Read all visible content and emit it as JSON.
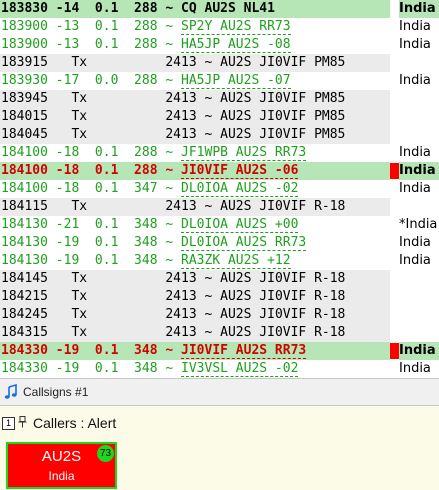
{
  "colors": {
    "rx": "#1fa01f",
    "tx": "#000000",
    "alert": "#d40000",
    "highlight_bg": "#b6e6b6",
    "tx_bg": "#ebebeb",
    "card_bg": "#ff0000",
    "card_border": "#1fd61f"
  },
  "log": [
    {
      "time": "183830",
      "db": "-14",
      "dt": "0.1",
      "freq": "288",
      "sep": "~",
      "msg": "CQ AU2S NL41",
      "country": "India",
      "style": "highlight",
      "mark": ""
    },
    {
      "time": "183900",
      "db": "-13",
      "dt": "0.1",
      "freq": "288",
      "sep": "~",
      "msg": "SP2Y AU2S RR73",
      "country": "India",
      "style": "rx",
      "mark": ""
    },
    {
      "time": "183900",
      "db": "-13",
      "dt": "0.1",
      "freq": "288",
      "sep": "~",
      "msg": "HA5JP AU2S -08",
      "country": "India",
      "style": "rx",
      "mark": ""
    },
    {
      "time": "183915",
      "db": "Tx",
      "dt": "",
      "freq": "2413",
      "sep": "~",
      "msg": "AU2S JI0VIF PM85",
      "country": "",
      "style": "tx",
      "mark": ""
    },
    {
      "time": "183930",
      "db": "-17",
      "dt": "0.0",
      "freq": "288",
      "sep": "~",
      "msg": "HA5JP AU2S -07",
      "country": "India",
      "style": "rx",
      "mark": ""
    },
    {
      "time": "183945",
      "db": "Tx",
      "dt": "",
      "freq": "2413",
      "sep": "~",
      "msg": "AU2S JI0VIF PM85",
      "country": "",
      "style": "tx",
      "mark": ""
    },
    {
      "time": "184015",
      "db": "Tx",
      "dt": "",
      "freq": "2413",
      "sep": "~",
      "msg": "AU2S JI0VIF PM85",
      "country": "",
      "style": "tx",
      "mark": ""
    },
    {
      "time": "184045",
      "db": "Tx",
      "dt": "",
      "freq": "2413",
      "sep": "~",
      "msg": "AU2S JI0VIF PM85",
      "country": "",
      "style": "tx",
      "mark": ""
    },
    {
      "time": "184100",
      "db": "-18",
      "dt": "0.1",
      "freq": "288",
      "sep": "~",
      "msg": "JF1WPB AU2S RR73",
      "country": "India",
      "style": "rx",
      "mark": ""
    },
    {
      "time": "184100",
      "db": "-18",
      "dt": "0.1",
      "freq": "288",
      "sep": "~",
      "msg": "JI0VIF AU2S -06",
      "country": "India",
      "style": "alert",
      "mark": "red"
    },
    {
      "time": "184100",
      "db": "-18",
      "dt": "0.1",
      "freq": "347",
      "sep": "~",
      "msg": "DL0IOA AU2S -02",
      "country": "India",
      "style": "rx",
      "mark": ""
    },
    {
      "time": "184115",
      "db": "Tx",
      "dt": "",
      "freq": "2413",
      "sep": "~",
      "msg": "AU2S JI0VIF R-18",
      "country": "",
      "style": "tx",
      "mark": ""
    },
    {
      "time": "184130",
      "db": "-21",
      "dt": "0.1",
      "freq": "348",
      "sep": "~",
      "msg": "DL0IOA AU2S +00",
      "country": "*India",
      "style": "rx",
      "mark": ""
    },
    {
      "time": "184130",
      "db": "-19",
      "dt": "0.1",
      "freq": "348",
      "sep": "~",
      "msg": "DL0IOA AU2S RR73",
      "country": "India",
      "style": "rx",
      "mark": ""
    },
    {
      "time": "184130",
      "db": "-19",
      "dt": "0.1",
      "freq": "348",
      "sep": "~",
      "msg": "RA3ZK AU2S +12",
      "country": "India",
      "style": "rx",
      "mark": ""
    },
    {
      "time": "184145",
      "db": "Tx",
      "dt": "",
      "freq": "2413",
      "sep": "~",
      "msg": "AU2S JI0VIF R-18",
      "country": "",
      "style": "tx",
      "mark": ""
    },
    {
      "time": "184215",
      "db": "Tx",
      "dt": "",
      "freq": "2413",
      "sep": "~",
      "msg": "AU2S JI0VIF R-18",
      "country": "",
      "style": "tx",
      "mark": ""
    },
    {
      "time": "184245",
      "db": "Tx",
      "dt": "",
      "freq": "2413",
      "sep": "~",
      "msg": "AU2S JI0VIF R-18",
      "country": "",
      "style": "tx",
      "mark": ""
    },
    {
      "time": "184315",
      "db": "Tx",
      "dt": "",
      "freq": "2413",
      "sep": "~",
      "msg": "AU2S JI0VIF R-18",
      "country": "",
      "style": "tx",
      "mark": ""
    },
    {
      "time": "184330",
      "db": "-19",
      "dt": "0.1",
      "freq": "348",
      "sep": "~",
      "msg": "JI0VIF AU2S RR73",
      "country": "India",
      "style": "alert",
      "mark": "red"
    },
    {
      "time": "184330",
      "db": "-19",
      "dt": "0.1",
      "freq": "348",
      "sep": "~",
      "msg": "IV3VSL AU2S -02",
      "country": "India",
      "style": "rx",
      "mark": ""
    }
  ],
  "tabbar": {
    "tab_label": "Callsigns #1",
    "tab_icon": "music-note-icon"
  },
  "panel": {
    "number": "1",
    "pin_icon": "pin-icon",
    "title": "Callers : Alert"
  },
  "card": {
    "callsign": "AU2S",
    "country": "India",
    "badge": "73"
  }
}
